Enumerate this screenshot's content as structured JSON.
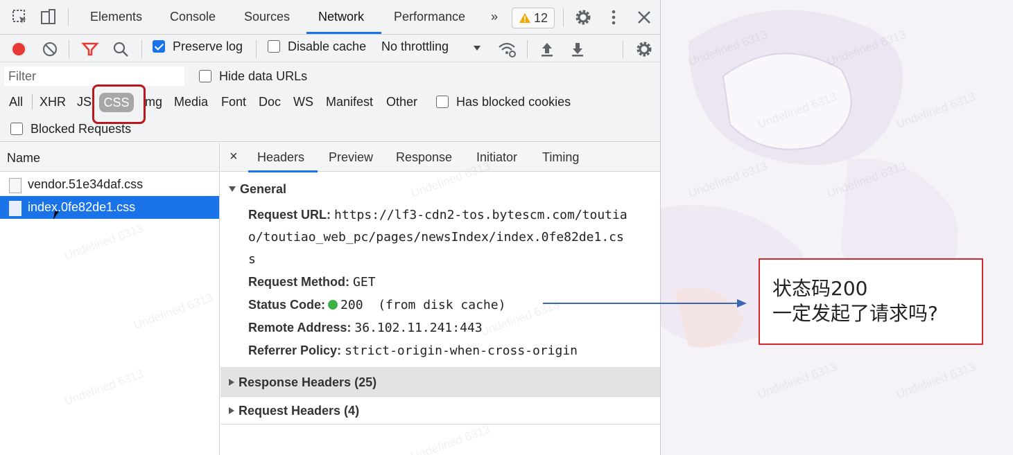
{
  "tabbar": {
    "tabs": [
      "Elements",
      "Console",
      "Sources",
      "Network",
      "Performance"
    ],
    "active_tab": "Network",
    "more": "»",
    "warning_count": "12"
  },
  "toolbar": {
    "preserve_log": "Preserve log",
    "disable_cache": "Disable cache",
    "throttling": "No throttling"
  },
  "filter": {
    "placeholder": "Filter",
    "hide_data_urls": "Hide data URLs",
    "types": [
      "All",
      "XHR",
      "JS",
      "CSS",
      "Img",
      "Media",
      "Font",
      "Doc",
      "WS",
      "Manifest",
      "Other"
    ],
    "active_type": "CSS",
    "has_blocked_cookies": "Has blocked cookies",
    "blocked_requests": "Blocked Requests"
  },
  "list": {
    "header": "Name",
    "rows": [
      "vendor.51e34daf.css",
      "index.0fe82de1.css"
    ]
  },
  "details": {
    "close": "×",
    "tabs": [
      "Headers",
      "Preview",
      "Response",
      "Initiator",
      "Timing"
    ],
    "general": {
      "title": "General",
      "request_url_label": "Request URL:",
      "request_url_lines": [
        "https://lf3-cdn2-tos.bytescm.com/toutia",
        "o/toutiao_web_pc/pages/newsIndex/index.0fe82de1.cs",
        "s"
      ],
      "method_label": "Request Method:",
      "method": "GET",
      "status_label": "Status Code:",
      "status": "200  (from disk cache)",
      "remote_label": "Remote Address:",
      "remote": "36.102.11.241:443",
      "referrer_label": "Referrer Policy:",
      "referrer": "strict-origin-when-cross-origin"
    },
    "response_headers": "Response Headers (25)",
    "request_headers": "Request Headers (4)"
  },
  "callout": {
    "line1": "状态码200",
    "line2": "一定发起了请求吗?"
  },
  "watermark": "Undefined 6313",
  "colors": {
    "accent": "#1a73e8",
    "highlight_box": "#b8181e",
    "callout_border": "#d8262b",
    "arrow": "#3a66b8",
    "status_ok": "#3cb043"
  }
}
